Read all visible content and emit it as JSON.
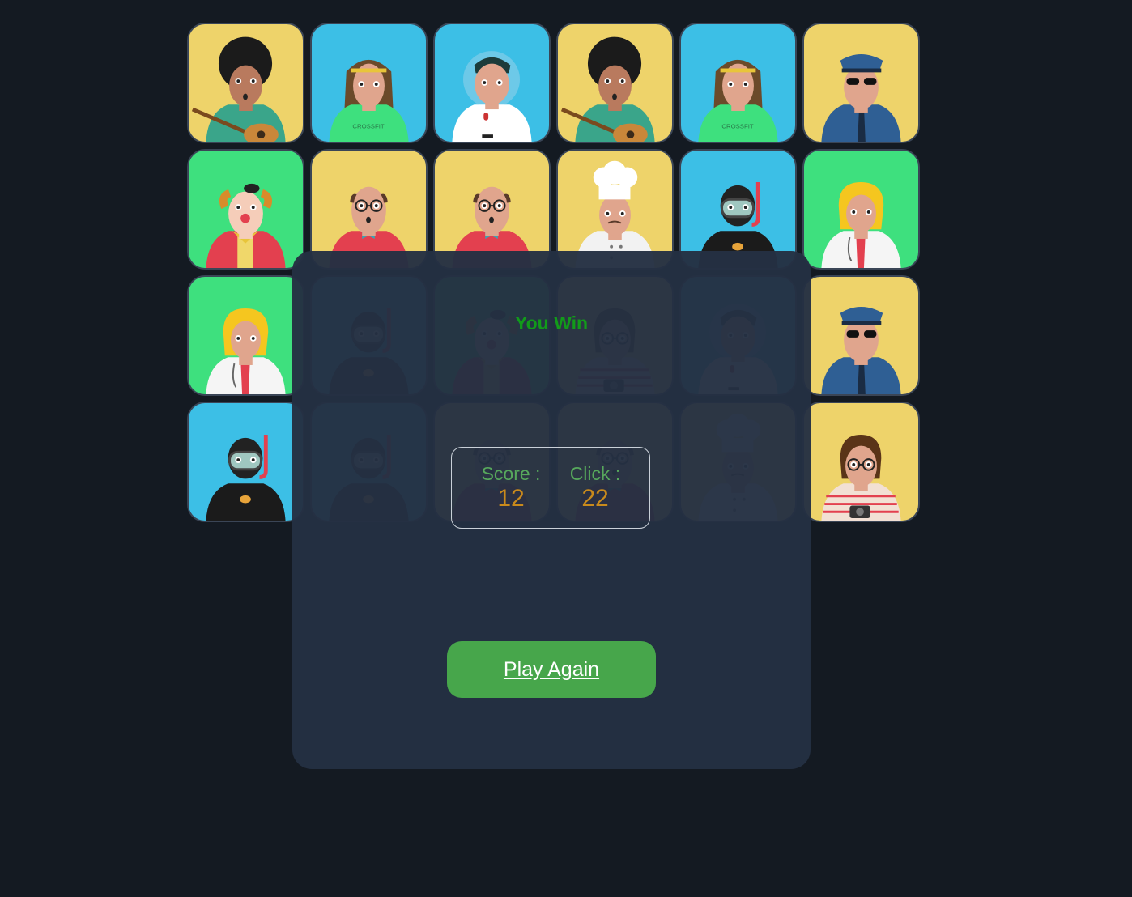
{
  "grid": {
    "rows": 4,
    "cols": 6,
    "cards": [
      {
        "character": "afro-guitarist",
        "bg": "#eed36a"
      },
      {
        "character": "bald-longhair-hipster",
        "bg": "#3cbfe6"
      },
      {
        "character": "astronaut",
        "bg": "#3cbfe6"
      },
      {
        "character": "afro-guitarist",
        "bg": "#eed36a"
      },
      {
        "character": "bald-longhair-hipster",
        "bg": "#3cbfe6"
      },
      {
        "character": "police-officer",
        "bg": "#eed36a"
      },
      {
        "character": "clown",
        "bg": "#3ee07e"
      },
      {
        "character": "bald-glasses-man",
        "bg": "#eed36a"
      },
      {
        "character": "bald-glasses-man",
        "bg": "#eed36a"
      },
      {
        "character": "chef",
        "bg": "#eed36a"
      },
      {
        "character": "scuba-diver",
        "bg": "#3cbfe6"
      },
      {
        "character": "blonde-doctor",
        "bg": "#3ee07e"
      },
      {
        "character": "blonde-doctor",
        "bg": "#3ee07e"
      },
      {
        "character": "scuba-diver",
        "bg": "#3cbfe6"
      },
      {
        "character": "clown",
        "bg": "#3ee07e"
      },
      {
        "character": "photographer",
        "bg": "#eed36a"
      },
      {
        "character": "astronaut",
        "bg": "#3cbfe6"
      },
      {
        "character": "police-officer",
        "bg": "#eed36a"
      },
      {
        "character": "scuba-diver",
        "bg": "#3cbfe6"
      },
      {
        "character": "scuba-diver",
        "bg": "#3cbfe6"
      },
      {
        "character": "bald-glasses-man",
        "bg": "#eed36a"
      },
      {
        "character": "bald-glasses-man",
        "bg": "#eed36a"
      },
      {
        "character": "chef",
        "bg": "#eed36a"
      },
      {
        "character": "photographer",
        "bg": "#eed36a"
      }
    ]
  },
  "result": {
    "title": "You Win",
    "score_label": "Score :",
    "score_value": "12",
    "click_label": "Click :",
    "click_value": "22",
    "play_again": "Play Again"
  },
  "colors": {
    "background": "#141a22",
    "overlay": "#243042",
    "win_text": "#129b1a",
    "stat_label": "#57a85c",
    "stat_value": "#c98a1c",
    "button": "#47a64b"
  }
}
